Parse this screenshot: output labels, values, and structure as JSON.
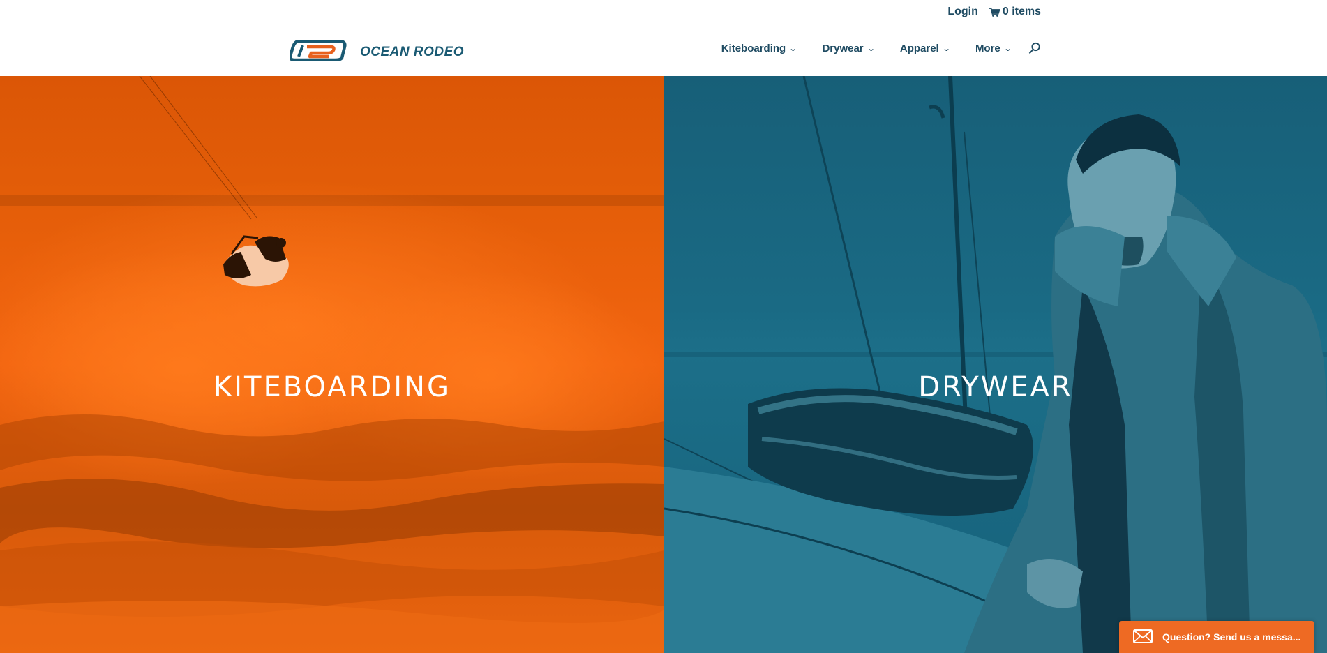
{
  "topbar": {
    "login_label": "Login",
    "cart_label": "0 items"
  },
  "logo": {
    "text": "OCEAN RODEO"
  },
  "nav": {
    "items": [
      {
        "label": "Kiteboarding"
      },
      {
        "label": "Drywear"
      },
      {
        "label": "Apparel"
      },
      {
        "label": "More"
      }
    ]
  },
  "hero": {
    "left_title": "KITEBOARDING",
    "right_title": "DRYWEAR"
  },
  "chat": {
    "label": "Question? Send us a messa..."
  },
  "icons": {
    "cart": "cart-icon",
    "search": "search-icon",
    "chevron": "chevron-down-icon",
    "envelope": "envelope-icon"
  },
  "colors": {
    "brand_blue": "#1f4b62",
    "brand_orange": "#ee6a23",
    "left_overlay": "#f2640f",
    "right_overlay": "#1a6b85"
  }
}
